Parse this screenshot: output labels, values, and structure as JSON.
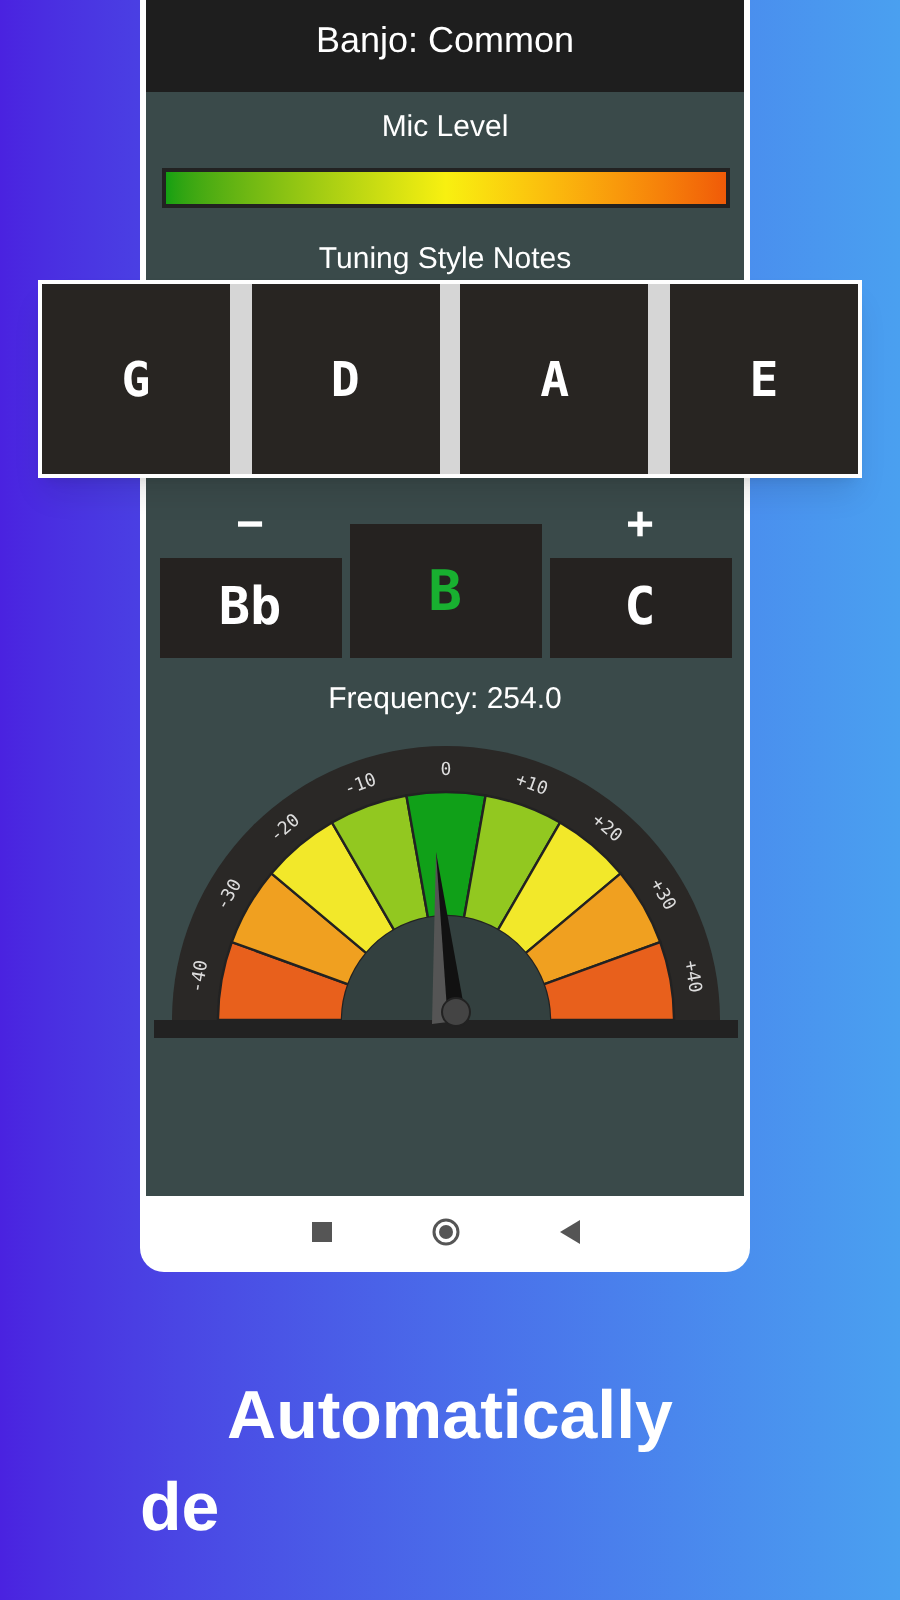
{
  "app_bar": {
    "title": "Banjo: Common"
  },
  "mic_level": {
    "label": "Mic Level"
  },
  "tuning_notes": {
    "label": "Tuning Style Notes",
    "notes": [
      "G",
      "D",
      "A",
      "E"
    ]
  },
  "note_nav": {
    "minus": "−",
    "plus": "+",
    "previous": "Bb",
    "current": "B",
    "next": "C"
  },
  "frequency": "Frequency: 254.0",
  "gauge": {
    "segments": [
      {
        "label": "-40",
        "color": "#e8601c"
      },
      {
        "label": "-30",
        "color": "#f0a020"
      },
      {
        "label": "-20",
        "color": "#f2e82a"
      },
      {
        "label": "-10",
        "color": "#92c820"
      },
      {
        "label": "0",
        "color": "#10a018"
      },
      {
        "label": "+10",
        "color": "#92c820"
      },
      {
        "label": "+20",
        "color": "#f2e82a"
      },
      {
        "label": "+30",
        "color": "#f0a020"
      },
      {
        "label": "+40",
        "color": "#e8601c"
      }
    ]
  },
  "caption": {
    "line_1": "Automatically",
    "line_2": "de"
  }
}
